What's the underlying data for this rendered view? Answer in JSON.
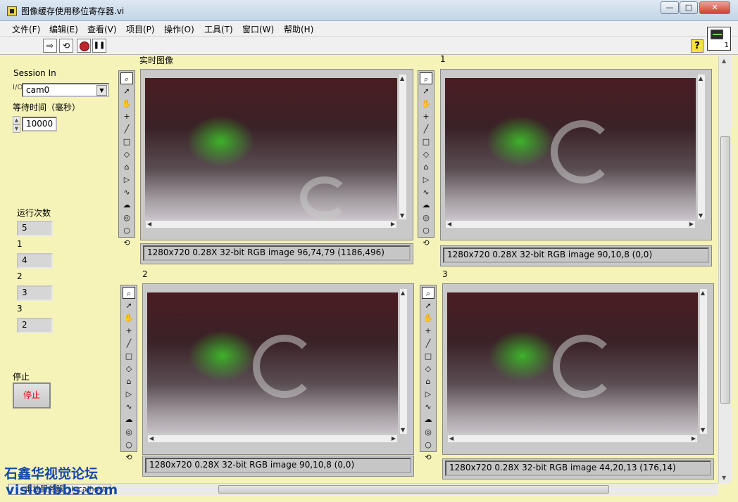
{
  "window": {
    "title": "图像缓存使用移位寄存器.vi",
    "buttons": {
      "minimize": "—",
      "maximize": "□",
      "close": "✕"
    }
  },
  "menu": [
    "文件(F)",
    "编辑(E)",
    "查看(V)",
    "项目(P)",
    "操作(O)",
    "工具(T)",
    "窗口(W)",
    "帮助(H)"
  ],
  "toolbar": {
    "run": "⇨",
    "run_continuously": "⟲",
    "abort": "",
    "pause": "❚❚",
    "help": "?",
    "connector_number": "1"
  },
  "controls": {
    "session_label": "Session In",
    "session_value": "cam0",
    "wait_label": "等待时间（毫秒）",
    "wait_value": "10000",
    "run_count_label": "运行次数",
    "run_count_value": "5",
    "indicators": [
      {
        "label": "1",
        "value": "4"
      },
      {
        "label": "2",
        "value": "3"
      },
      {
        "label": "3",
        "value": "2"
      }
    ],
    "stop_label": "停止",
    "stop_button": "停止"
  },
  "displays": [
    {
      "label": "实时图像",
      "info": "1280x720 0.28X 32-bit RGB image 96,74,79     (1186,496)"
    },
    {
      "label": "1",
      "info": "1280x720 0.28X 32-bit RGB image 90,10,8      (0,0)"
    },
    {
      "label": "2",
      "info": "1280x720 0.28X 32-bit RGB image 90,10,8      (0,0)"
    },
    {
      "label": "3",
      "info": "1280x720 0.28X 32-bit RGB image 44,20,13      (176,14)"
    }
  ],
  "tool_icons": [
    "zoom-icon",
    "pointer-icon",
    "pan-icon",
    "point-icon",
    "line-icon",
    "rectangle-icon",
    "rotated-rectangle-icon",
    "polygon-icon",
    "broken-line-icon",
    "freehand-line-icon",
    "freehand-region-icon",
    "annulus-icon",
    "oval-icon",
    "zoom-rotate-icon"
  ],
  "statusbar": {
    "server": "本地服务器：localhost"
  },
  "watermark": {
    "line1": "石鑫华视觉论坛",
    "line2": "visionbbs.com"
  },
  "colors": {
    "panel_bg": "#f5f3b8",
    "stop_text": "#e00000",
    "watermark": "#1448a8"
  }
}
